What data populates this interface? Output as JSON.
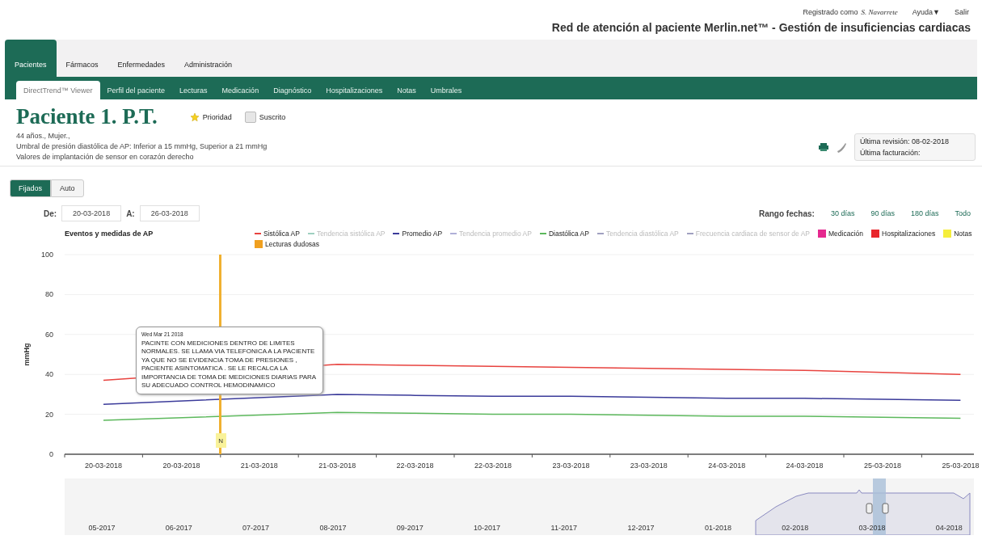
{
  "top_bar": {
    "logged_in_label": "Registrado como",
    "user": "S. Navarrete",
    "help": "Ayuda▼",
    "logout": "Salir"
  },
  "app_title": "Red de atención al paciente Merlin.net™ - Gestión de insuficiencias cardiacas",
  "tabs": [
    {
      "label": "Pacientes",
      "selected": true
    },
    {
      "label": "Fármacos",
      "selected": false
    },
    {
      "label": "Enfermedades",
      "selected": false
    },
    {
      "label": "Administración",
      "selected": false
    }
  ],
  "subtabs": [
    {
      "label": "DirectTrend™ Viewer",
      "selected": true
    },
    {
      "label": "Perfil del paciente",
      "selected": false
    },
    {
      "label": "Lecturas",
      "selected": false
    },
    {
      "label": "Medicación",
      "selected": false
    },
    {
      "label": "Diagnóstico",
      "selected": false
    },
    {
      "label": "Hospitalizaciones",
      "selected": false
    },
    {
      "label": "Notas",
      "selected": false
    },
    {
      "label": "Umbrales",
      "selected": false
    }
  ],
  "patient": {
    "name": "Paciente 1. P.T.",
    "priority": "Prioridad",
    "subscribed": "Suscrito",
    "subscribed_checked": false,
    "info": "44 años., Mujer.,",
    "threshold": "Umbral de presión diastólica de AP: Inferior a 15 mmHg, Superior a 21 mmHg",
    "implant": "Valores de implantación de sensor en corazón derecho",
    "last_review": "Última revisión: 08-02-2018",
    "last_billing": "Última facturación:"
  },
  "scale_toggle": [
    {
      "label": "Fijados",
      "selected": true
    },
    {
      "label": "Auto",
      "selected": false
    }
  ],
  "date_from_label": "De:",
  "date_from": "20-03-2018",
  "date_to_label": "A:",
  "date_to": "26-03-2018",
  "range_label": "Rango fechas:",
  "ranges": [
    "30 días",
    "90 días",
    "180 días",
    "Todo"
  ],
  "legend": [
    {
      "kind": "line",
      "label": "Tendencia sistólica AP",
      "color": "#9fd0c0",
      "visible": false
    },
    {
      "kind": "line",
      "label": "Tendencia promedio AP",
      "color": "#b0b0d8",
      "visible": false
    },
    {
      "kind": "line",
      "label": "Tendencia diastólica AP",
      "color": "#a0a0c0",
      "visible": false
    },
    {
      "kind": "line",
      "label": "Frecuencia cardiaca de sensor de AP",
      "color": "#a0a0c0",
      "visible": false
    },
    {
      "kind": "box",
      "label": "Medicación",
      "color": "#e5298f",
      "visible": true
    },
    {
      "kind": "box",
      "label": "Hospitalizaciones",
      "color": "#e8262c",
      "visible": true
    },
    {
      "kind": "box",
      "label": "Notas",
      "color": "#f5ee3c",
      "visible": true
    },
    {
      "kind": "box",
      "label": "Lecturas dudosas",
      "color": "#f0a020",
      "visible": true
    }
  ],
  "chart_data": {
    "type": "line",
    "grid": true,
    "title": "Eventos y medidas de AP",
    "ylabel": "mmHg",
    "ylim": [
      0,
      100
    ],
    "yticks": [
      0,
      20,
      40,
      60,
      80,
      100
    ],
    "categories": [
      "20-03-2018",
      "20-03-2018",
      "21-03-2018",
      "21-03-2018",
      "22-03-2018",
      "22-03-2018",
      "23-03-2018",
      "23-03-2018",
      "24-03-2018",
      "24-03-2018",
      "25-03-2018",
      "25-03-2018"
    ],
    "series": [
      {
        "name": "Sistólica AP",
        "color": "#e8433f",
        "values": [
          37,
          null,
          null,
          45,
          44.5,
          44,
          43.5,
          43,
          42.5,
          42,
          41,
          40
        ]
      },
      {
        "name": "Promedio AP",
        "color": "#3b3b9a",
        "values": [
          25,
          null,
          null,
          30,
          29.5,
          29,
          29,
          28.5,
          28,
          28,
          27.5,
          27
        ]
      },
      {
        "name": "Diastólica AP",
        "color": "#5cb85c",
        "values": [
          17,
          null,
          null,
          21,
          20.5,
          20,
          20,
          19.5,
          19,
          19,
          18.5,
          18
        ]
      }
    ]
  },
  "note_marker": "N",
  "tooltip": {
    "date": "Wed Mar 21 2018",
    "text": "PACINTE CON MEDICIONES DENTRO DE LIMITES NORMALES. SE LLAMA VIA TELEFONICA A LA PACIENTE YA QUE NO SE EVIDENCIA TOMA DE PRESIONES , PACIENTE ASINTOMATICA . SE LE RECALCA LA IMPORTANCIA DE TOMA DE MEDICIONES DIARIAS PARA SU ADECUADO CONTROL HEMODINAMICO"
  },
  "navigator_months": [
    "05-2017",
    "06-2017",
    "07-2017",
    "08-2017",
    "09-2017",
    "10-2017",
    "11-2017",
    "12-2017",
    "01-2018",
    "02-2018",
    "03-2018",
    "04-2018"
  ]
}
